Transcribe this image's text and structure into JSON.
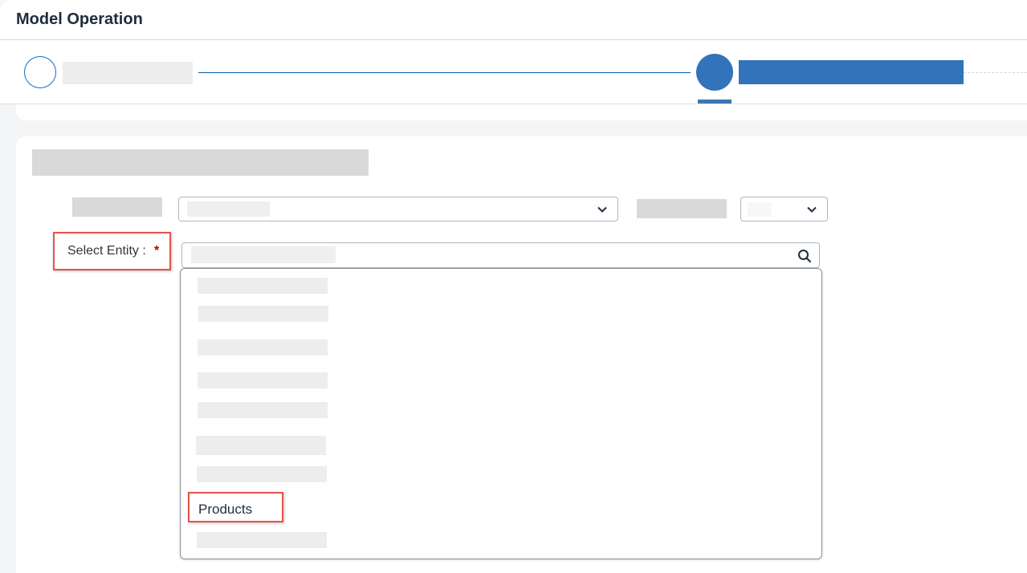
{
  "header": {
    "title": "Model Operation"
  },
  "form": {
    "entity_label": "Select Entity :",
    "required_mark": "*"
  },
  "dropdown": {
    "options": [
      {
        "label": ""
      },
      {
        "label": ""
      },
      {
        "label": ""
      },
      {
        "label": ""
      },
      {
        "label": ""
      },
      {
        "label": ""
      },
      {
        "label": ""
      },
      {
        "label": "Products"
      },
      {
        "label": ""
      }
    ]
  },
  "icons": {
    "search": "search-icon",
    "chevron": "chevron-down-icon"
  },
  "colors": {
    "accent": "#3273b9",
    "highlight_border": "#e5534b",
    "required": "#aa0808",
    "title_text": "#1d2d3e"
  }
}
